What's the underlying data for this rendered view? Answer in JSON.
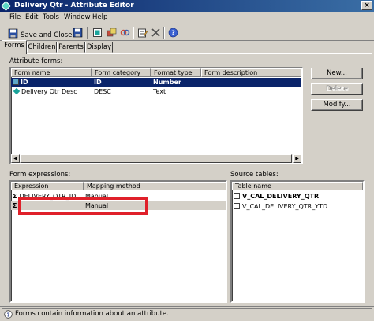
{
  "window": {
    "title": "Delivery Qtr - Attribute Editor",
    "close_glyph": "×"
  },
  "menu": [
    "File",
    "Edit",
    "Tools",
    "Window",
    "Help"
  ],
  "toolbar": {
    "save_close_label": "Save and Close",
    "icons": [
      "save-close-icon",
      "save-icon",
      "new-form-icon",
      "attribute-icon",
      "link-icon",
      "properties-icon",
      "delete-icon",
      "help-icon"
    ]
  },
  "tabs": [
    "Forms",
    "Children",
    "Parents",
    "Display"
  ],
  "attribute_forms": {
    "label": "Attribute forms:",
    "columns": [
      "Form name",
      "Form category",
      "Format type",
      "Form description"
    ],
    "rows": [
      {
        "name": "ID",
        "category": "ID",
        "format": "Number",
        "description": "",
        "selected": true
      },
      {
        "name": "Delivery Qtr Desc",
        "category": "DESC",
        "format": "Text",
        "description": "",
        "selected": false
      }
    ]
  },
  "buttons": {
    "new": "New...",
    "delete": "Delete",
    "modify": "Modify..."
  },
  "form_expressions": {
    "label": "Form expressions:",
    "columns": [
      "Expression",
      "Mapping method"
    ],
    "rows": [
      {
        "expression": "DELIVERY_QTR_ID",
        "mapping": "Manual"
      },
      {
        "expression": "",
        "mapping": "Manual"
      }
    ]
  },
  "source_tables": {
    "label": "Source tables:",
    "column": "Table name",
    "rows": [
      {
        "name": "V_CAL_DELIVERY_QTR",
        "bold": true
      },
      {
        "name": "V_CAL_DELIVERY_QTR_YTD",
        "bold": false
      }
    ]
  },
  "status": {
    "text": "Forms contain information about an attribute."
  },
  "colors": {
    "titlebar": "#0a246a",
    "selection": "#0a246a",
    "highlight_box": "#e0202a"
  }
}
